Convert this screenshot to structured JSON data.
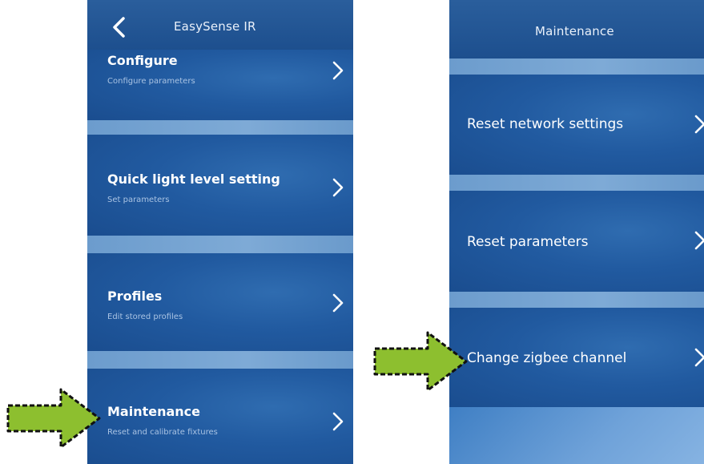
{
  "left_screen": {
    "title": "EasySense IR",
    "items": [
      {
        "label": "Configure",
        "sub": "Configure parameters"
      },
      {
        "label": "Quick light level setting",
        "sub": "Set parameters"
      },
      {
        "label": "Profiles",
        "sub": "Edit stored profiles"
      },
      {
        "label": "Maintenance",
        "sub": "Reset and calibrate fixtures"
      }
    ]
  },
  "right_screen": {
    "title": "Maintenance",
    "items": [
      {
        "label": "Reset network settings"
      },
      {
        "label": "Reset parameters"
      },
      {
        "label": "Change zigbee channel"
      }
    ]
  },
  "colors": {
    "header": "#1d4f8e",
    "item_bg": "#215aa0",
    "separator": "#7eaad6",
    "arrow_fill": "#8dbf2f",
    "arrow_outline": "#111111"
  },
  "icons": {
    "back": "chevron-left-icon",
    "row": "chevron-right-icon",
    "pointer": "green-arrow-icon"
  }
}
